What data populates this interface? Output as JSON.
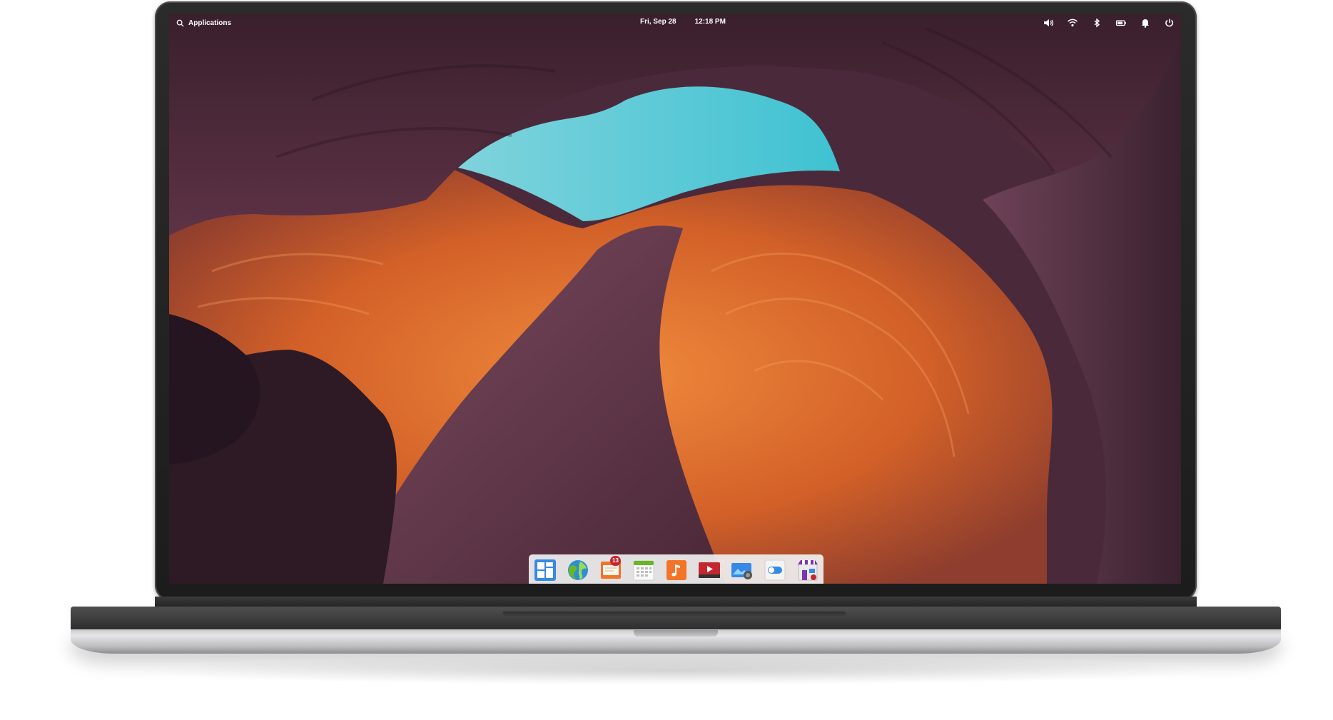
{
  "top_panel": {
    "applications_label": "Applications",
    "date": "Fri, Sep 28",
    "time": "12:18 PM",
    "indicators": [
      "volume-icon",
      "wifi-icon",
      "bluetooth-icon",
      "battery-icon",
      "notifications-icon",
      "power-icon"
    ]
  },
  "dock": {
    "items": [
      {
        "name": "multitasking-view",
        "icon": "multitasking-icon"
      },
      {
        "name": "web-browser",
        "icon": "browser-globe-icon"
      },
      {
        "name": "mail",
        "icon": "mail-icon",
        "badge": "13"
      },
      {
        "name": "calendar",
        "icon": "calendar-icon"
      },
      {
        "name": "music",
        "icon": "music-note-icon"
      },
      {
        "name": "videos",
        "icon": "video-play-icon"
      },
      {
        "name": "photos",
        "icon": "photos-icon"
      },
      {
        "name": "system-settings",
        "icon": "settings-toggle-icon"
      },
      {
        "name": "appcenter",
        "icon": "appcenter-store-icon"
      }
    ]
  },
  "colors": {
    "panel_text": "#ffffff",
    "badge": "#c6262e",
    "sky": "#4fc6d6",
    "rock_orange": "#d8642a",
    "rock_purple": "#5c3347"
  }
}
